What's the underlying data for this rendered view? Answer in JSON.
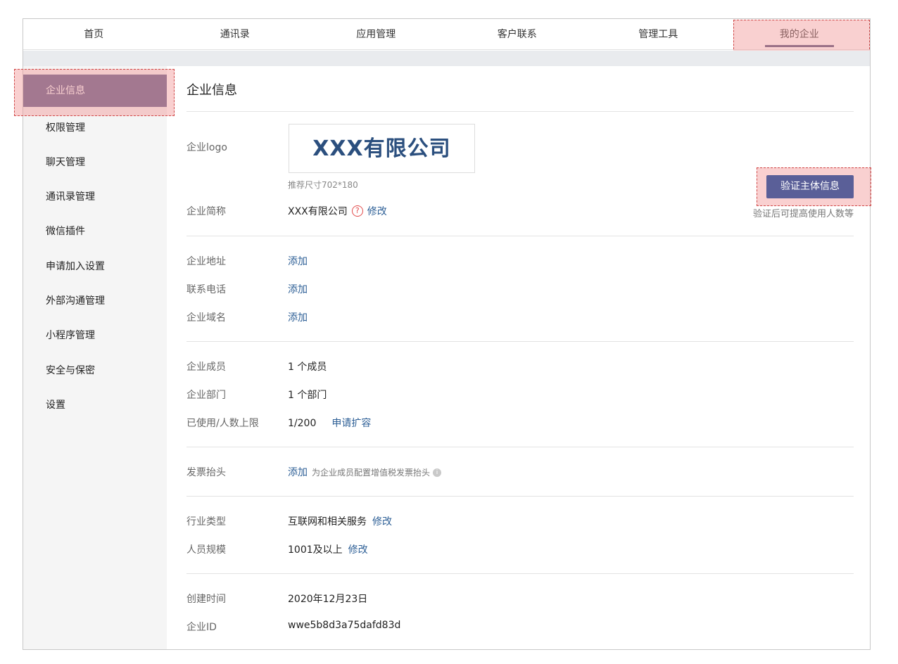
{
  "topnav": {
    "tabs": [
      {
        "label": "首页"
      },
      {
        "label": "通讯录"
      },
      {
        "label": "应用管理"
      },
      {
        "label": "客户联系"
      },
      {
        "label": "管理工具"
      },
      {
        "label": "我的企业"
      }
    ],
    "active": "我的企业"
  },
  "sidebar": {
    "items": [
      {
        "label": "企业信息"
      },
      {
        "label": "权限管理"
      },
      {
        "label": "聊天管理"
      },
      {
        "label": "通讯录管理"
      },
      {
        "label": "微信插件"
      },
      {
        "label": "申请加入设置"
      },
      {
        "label": "外部沟通管理"
      },
      {
        "label": "小程序管理"
      },
      {
        "label": "安全与保密"
      },
      {
        "label": "设置"
      }
    ],
    "active": "企业信息"
  },
  "main": {
    "title": "企业信息",
    "logo": {
      "label": "企业logo",
      "text": "XXX有限公司",
      "hint": "推荐尺寸702*180"
    },
    "verify": {
      "button": "验证主体信息",
      "note": "验证后可提高使用人数等"
    },
    "short_name": {
      "label": "企业简称",
      "value": "XXX有限公司",
      "help": "?",
      "edit": "修改"
    },
    "address": {
      "label": "企业地址",
      "action": "添加"
    },
    "phone": {
      "label": "联系电话",
      "action": "添加"
    },
    "domain": {
      "label": "企业域名",
      "action": "添加"
    },
    "members": {
      "label": "企业成员",
      "value": "1 个成员"
    },
    "departments": {
      "label": "企业部门",
      "value": "1 个部门"
    },
    "usage": {
      "label": "已使用/人数上限",
      "value": "1/200",
      "action": "申请扩容"
    },
    "invoice": {
      "label": "发票抬头",
      "action": "添加",
      "note": "为企业成员配置增值税发票抬头",
      "info": "i"
    },
    "industry": {
      "label": "行业类型",
      "value": "互联网和相关服务",
      "edit": "修改"
    },
    "scale": {
      "label": "人员规模",
      "value": "1001及以上",
      "edit": "修改"
    },
    "created": {
      "label": "创建时间",
      "value": "2020年12月23日"
    },
    "corp_id": {
      "label": "企业ID",
      "value": "wwe5b8d3a75dafd83d"
    }
  }
}
